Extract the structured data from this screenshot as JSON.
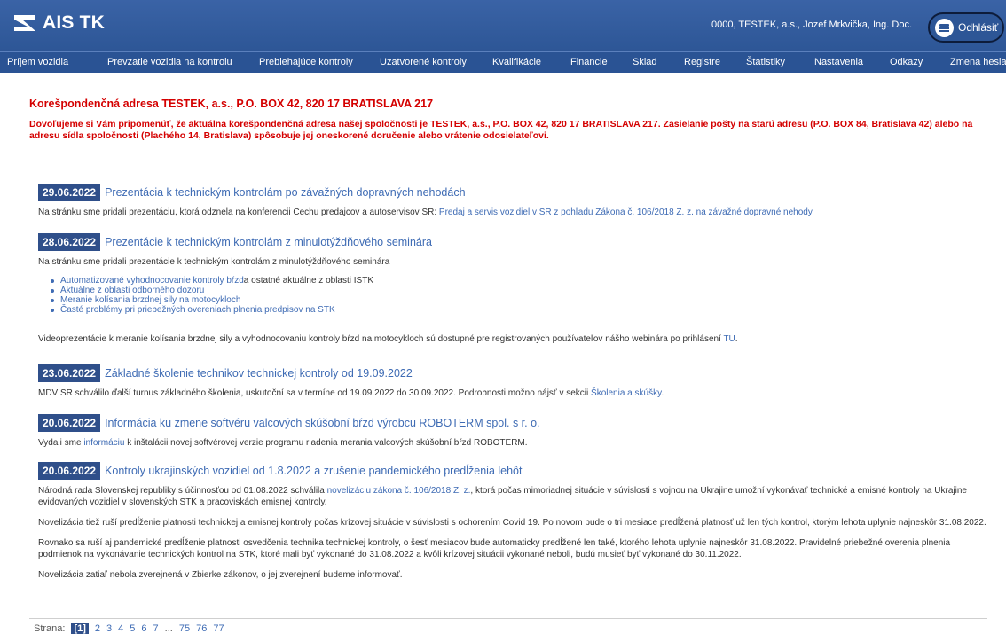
{
  "header": {
    "brand": "AIS TK",
    "user": "0000, TESTEK, a.s., Jozef Mrkvička, Ing. Doc.",
    "logout_label": "Odhlásiť"
  },
  "nav": [
    "Príjem vozidla",
    "Prevzatie vozidla na kontrolu",
    "Prebiehajúce kontroly",
    "Uzatvorené kontroly",
    "Kvalifikácie",
    "Financie",
    "Sklad",
    "Registre",
    "Štatistiky",
    "Nastavenia",
    "Odkazy",
    "Zmena hesla"
  ],
  "notice": {
    "title": "Korešpondenčná adresa TESTEK, a.s., P.O. BOX 42, 820 17 BRATISLAVA 217",
    "body": "Dovoľujeme si Vám pripomenúť, že aktuálna korešpondenčná adresa našej spoločnosti je TESTEK, a.s., P.O. BOX 42, 820 17 BRATISLAVA 217. Zasielanie pošty na starú adresu (P.O. BOX 84, Bratislava 42) alebo na adresu sídla spoločnosti (Plachého 14, Bratislava) spôsobuje jej oneskorené doručenie alebo vrátenie odosielateľovi."
  },
  "news": [
    {
      "date": "29.06.2022",
      "title": "Prezentácia k technickým kontrolám po závažných dopravných nehodách",
      "text_before": "Na stránku sme pridali prezentáciu, ktorá odznela na konferencii Cechu predajcov a autoservisov SR: ",
      "link": "Predaj a servis vozidiel v SR z pohľadu Zákona č. 106/2018 Z. z. na závažné dopravné nehody.",
      "text_after": ""
    },
    {
      "date": "28.06.2022",
      "title": "Prezentácie k technickým kontrolám z minulotýždňového seminára",
      "text": "Na stránku sme pridali prezentácie k technickým kontrolám z minulotýždňového seminára",
      "bullets": [
        {
          "link": "Automatizované vyhodnocovanie kontroly bŕzd",
          "rest": " a ostatné aktuálne z oblasti ISTK"
        },
        {
          "link": "Aktuálne z oblasti odborného dozoru",
          "rest": ""
        },
        {
          "link": "Meranie kolísania brzdnej sily na motocykloch",
          "rest": ""
        },
        {
          "link": "Časté problémy pri priebežných overeniach plnenia predpisov na STK",
          "rest": ""
        }
      ],
      "video_text": "Videoprezentácie k meranie kolísania brzdnej sily a vyhodnocovaniu kontroly bŕzd na motocykloch sú dostupné pre registrovaných používateľov nášho webinára po prihlásení ",
      "video_link": "TU",
      "video_after": "."
    },
    {
      "date": "23.06.2022",
      "title": "Základné školenie technikov technickej kontroly od 19.09.2022",
      "text_before": "MDV SR schválilo ďalší turnus základného školenia, uskutoční sa v termíne od 19.09.2022 do 30.09.2022. Podrobnosti možno nájsť v sekcii ",
      "link": "Školenia a skúšky",
      "text_after": "."
    },
    {
      "date": "20.06.2022",
      "title": "Informácia ku zmene softvéru valcových skúšobní bŕzd výrobcu ROBOTERM spol. s r. o.",
      "text_before": "Vydali sme ",
      "link": "informáciu",
      "text_after": " k inštalácii novej softvérovej verzie programu riadenia merania valcových skúšobní bŕzd ROBOTERM."
    },
    {
      "date": "20.06.2022",
      "title": "Kontroly ukrajinských vozidiel od 1.8.2022 a zrušenie pandemického predĺženia lehôt",
      "text_before": "Národná rada Slovenskej republiky s účinnosťou od 01.08.2022 schválila ",
      "link": "novelizáciu zákona č. 106/2018 Z. z.",
      "text_after": ", ktorá počas mimoriadnej situácie v súvislosti s vojnou na Ukrajine umožní vykonávať technické a emisné kontroly na Ukrajine evidovaných vozidiel v slovenských STK a pracoviskách emisnej kontroly.",
      "para2": "Novelizácia tiež ruší predĺženie platnosti technickej a emisnej kontroly počas krízovej situácie v súvislosti s ochorením Covid 19. Po novom bude o tri mesiace predĺžená platnosť už len tých kontrol, ktorým lehota uplynie najneskôr 31.08.2022.",
      "para3": "Rovnako sa ruší aj pandemické predĺženie platnosti osvedčenia technika technickej kontroly, o šesť mesiacov bude automaticky predĺžené len také, ktorého lehota uplynie najneskôr 31.08.2022. Pravidelné priebežné overenia plnenia podmienok na vykonávanie technických kontrol na STK, ktoré mali byť vykonané do 31.08.2022 a kvôli krízovej situácii vykonané neboli, budú musieť byť vykonané do 30.11.2022.",
      "para4": "Novelizácia zatiaľ nebola zverejnená v Zbierke zákonov, o jej zverejnení budeme informovať."
    }
  ],
  "pager": {
    "label": "Strana:",
    "pages": [
      "[1]",
      "2",
      "3",
      "4",
      "5",
      "6",
      "7",
      "...",
      "75",
      "76",
      "77"
    ]
  }
}
